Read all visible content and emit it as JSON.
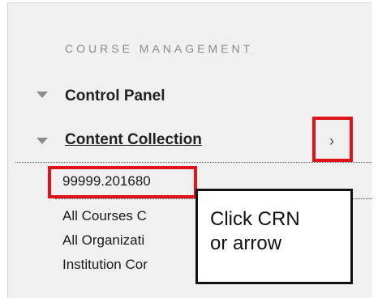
{
  "sidebar": {
    "header": "COURSE MANAGEMENT",
    "items": [
      {
        "label": "Control Panel",
        "icon": "triangle-down-icon"
      },
      {
        "label": "Content Collection",
        "icon": "triangle-down-icon",
        "expand_icon": "›"
      }
    ],
    "sub_items": [
      "99999.201680",
      "All Courses C",
      "All Organizati",
      "Institution Cor"
    ]
  },
  "annotation": {
    "text": "Click CRN\nor arrow",
    "highlight_color": "#e0121a"
  }
}
